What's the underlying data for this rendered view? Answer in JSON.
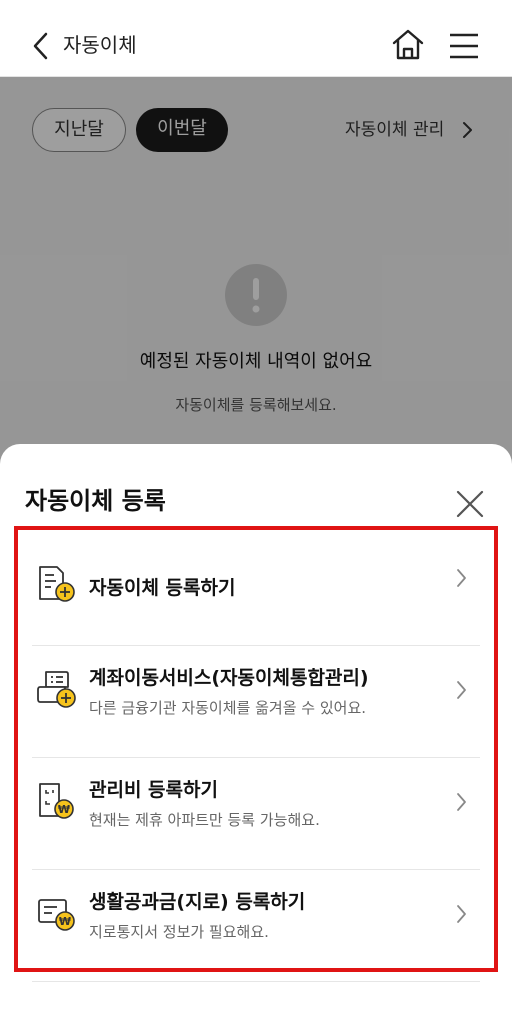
{
  "header": {
    "title": "자동이체",
    "back_icon": "chevron-left-icon",
    "home_icon": "home-icon",
    "menu_icon": "hamburger-menu-icon"
  },
  "background": {
    "tabs": [
      {
        "label": "지난달",
        "selected": false
      },
      {
        "label": "이번달",
        "selected": true
      }
    ],
    "manage_link": "자동이체 관리",
    "empty_title": "예정된 자동이체 내역이 없어요",
    "empty_subtitle": "자동이체를 등록해보세요.",
    "alert_icon": "exclamation-circle-icon"
  },
  "sheet": {
    "title": "자동이체 등록",
    "close_icon": "close-icon",
    "options": [
      {
        "title": "자동이체 등록하기",
        "desc": "",
        "icon": "document-plus-icon"
      },
      {
        "title": "계좌이동서비스(자동이체통합관리)",
        "desc": "다른 금융기관 자동이체를 옮겨올 수 있어요.",
        "icon": "transfer-plus-icon"
      },
      {
        "title": "관리비 등록하기",
        "desc": "현재는 제휴 아파트만 등록 가능해요.",
        "icon": "bill-won-icon"
      },
      {
        "title": "생활공과금(지로) 등록하기",
        "desc": "지로통지서 정보가 필요해요.",
        "icon": "giro-won-icon"
      }
    ]
  },
  "colors": {
    "highlight": "#e01414",
    "accent_yellow": "#f6c31c",
    "dark_pill": "#1c1c1c"
  }
}
